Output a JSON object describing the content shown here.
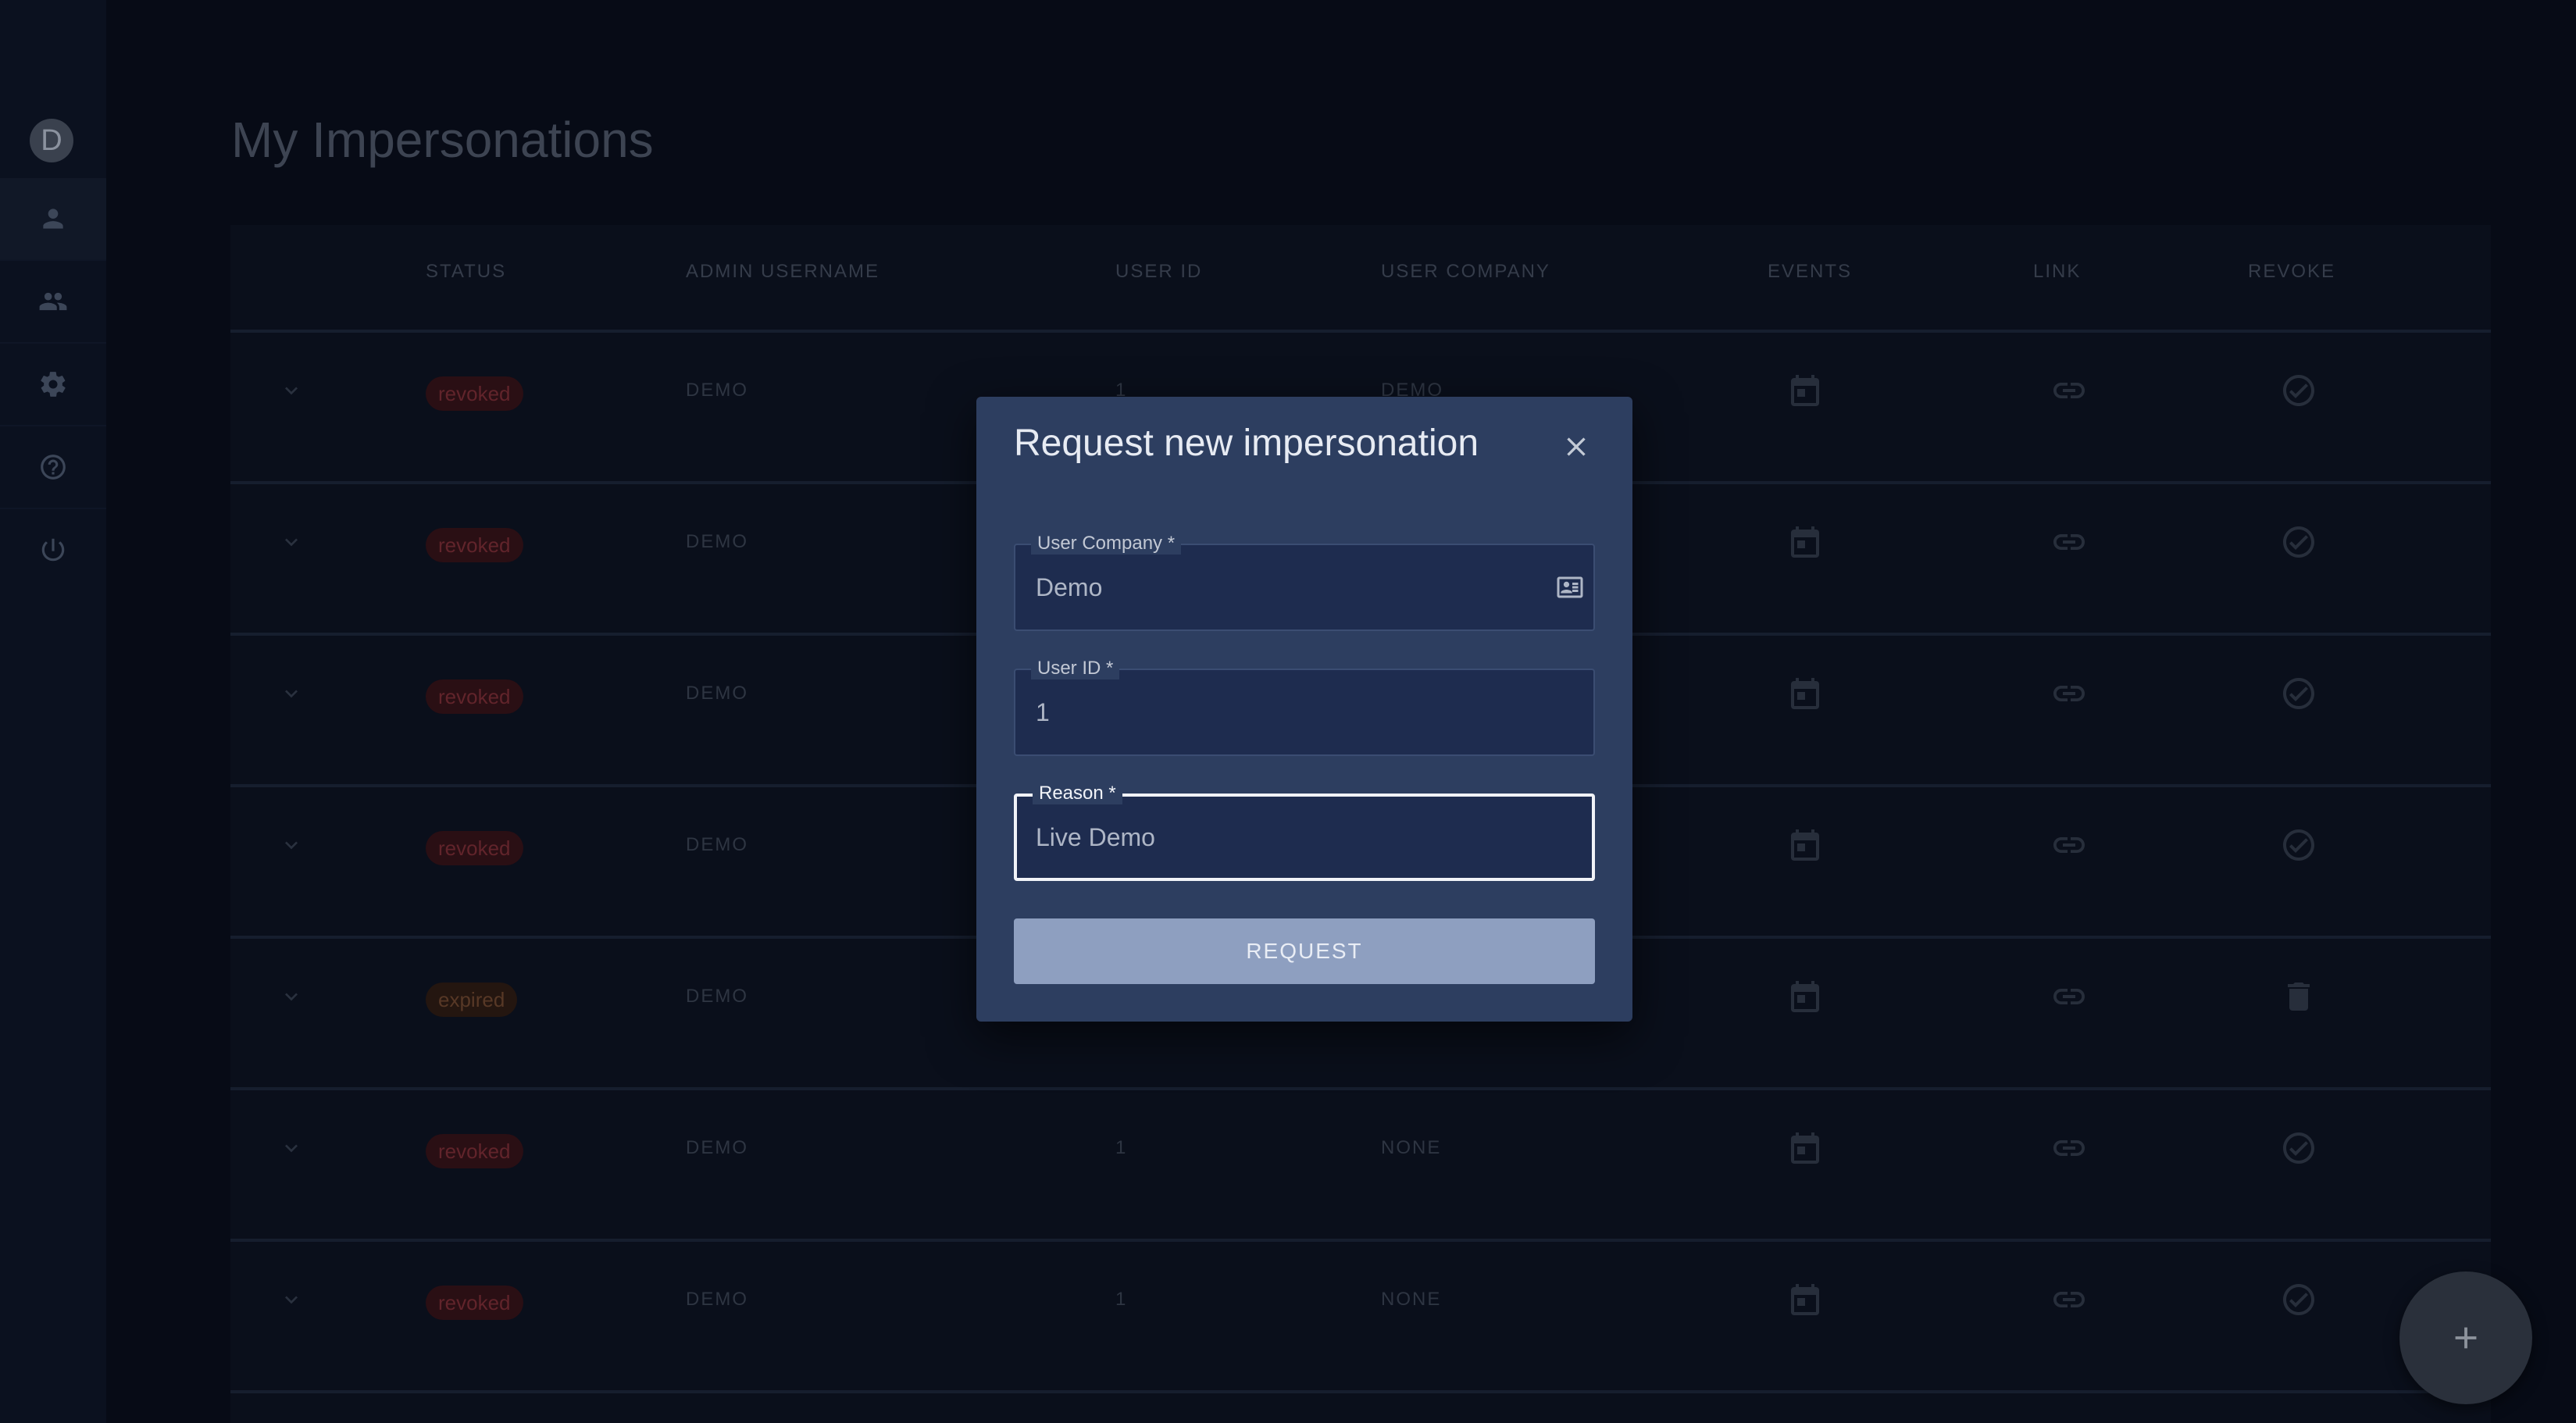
{
  "sidebar": {
    "avatar_letter": "D",
    "items": [
      {
        "icon": "person-icon",
        "active": true
      },
      {
        "icon": "group-icon",
        "active": false
      },
      {
        "icon": "gear-icon",
        "active": false
      },
      {
        "icon": "help-icon",
        "active": false
      },
      {
        "icon": "power-icon",
        "active": false
      }
    ]
  },
  "page": {
    "title": "My Impersonations"
  },
  "table": {
    "columns": [
      "STATUS",
      "ADMIN USERNAME",
      "USER ID",
      "USER COMPANY",
      "EVENTS",
      "LINK",
      "REVOKE"
    ],
    "rows": [
      {
        "status": "revoked",
        "admin": "DEMO",
        "user_id": "1",
        "company": "DEMO",
        "revoke_icon": "check-circle-icon"
      },
      {
        "status": "revoked",
        "admin": "DEMO",
        "user_id": "",
        "company": "",
        "revoke_icon": "check-circle-icon"
      },
      {
        "status": "revoked",
        "admin": "DEMO",
        "user_id": "",
        "company": "",
        "revoke_icon": "check-circle-icon"
      },
      {
        "status": "revoked",
        "admin": "DEMO",
        "user_id": "",
        "company": "",
        "revoke_icon": "check-circle-icon"
      },
      {
        "status": "expired",
        "admin": "DEMO",
        "user_id": "",
        "company": "",
        "revoke_icon": "trash-icon"
      },
      {
        "status": "revoked",
        "admin": "DEMO",
        "user_id": "1",
        "company": "NONE",
        "revoke_icon": "check-circle-icon"
      },
      {
        "status": "revoked",
        "admin": "DEMO",
        "user_id": "1",
        "company": "NONE",
        "revoke_icon": "check-circle-icon"
      }
    ]
  },
  "dialog": {
    "title": "Request new impersonation",
    "fields": {
      "company": {
        "label": "User Company *",
        "value": "Demo",
        "icon": "contact-card-icon"
      },
      "user_id": {
        "label": "User ID *",
        "value": "1"
      },
      "reason": {
        "label": "Reason *",
        "value": "Live Demo",
        "focused": true
      }
    },
    "submit_label": "REQUEST"
  },
  "fab": {
    "icon": "plus-icon"
  },
  "colors": {
    "background": "#070b16",
    "dialog": "#2d3e60",
    "field": "#1e2c4f",
    "button": "#8e9fc0",
    "revoked_badge": "#2a0f14",
    "expired_badge": "#241610"
  }
}
